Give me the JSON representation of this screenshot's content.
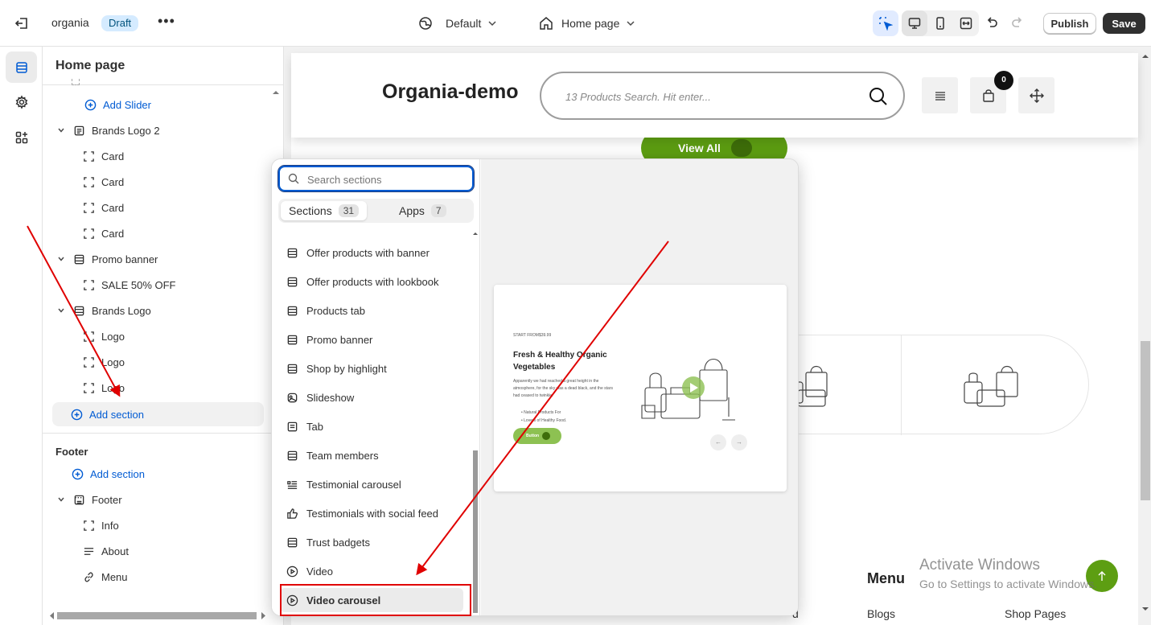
{
  "topbar": {
    "store_name": "organia",
    "status_badge": "Draft",
    "theme_label": "Default",
    "page_label": "Home page",
    "publish_label": "Publish",
    "save_label": "Save"
  },
  "sidebar": {
    "title": "Home page",
    "tree": [
      {
        "label": "Add Slider",
        "kind": "add",
        "icon": "plus-circle-icon"
      },
      {
        "label": "Brands Logo 2",
        "kind": "section",
        "icon": "section-icon"
      },
      {
        "label": "Card",
        "kind": "block",
        "icon": "block-icon"
      },
      {
        "label": "Card",
        "kind": "block",
        "icon": "block-icon"
      },
      {
        "label": "Card",
        "kind": "block",
        "icon": "block-icon"
      },
      {
        "label": "Card",
        "kind": "block",
        "icon": "block-icon"
      },
      {
        "label": "Promo banner",
        "kind": "section",
        "icon": "section-icon"
      },
      {
        "label": "SALE 50% OFF",
        "kind": "block",
        "icon": "block-icon"
      },
      {
        "label": "Brands Logo",
        "kind": "section",
        "icon": "section-icon"
      },
      {
        "label": "Logo",
        "kind": "block",
        "icon": "block-icon"
      },
      {
        "label": "Logo",
        "kind": "block",
        "icon": "block-icon"
      },
      {
        "label": "Logo",
        "kind": "block",
        "icon": "block-icon"
      }
    ],
    "add_section_label": "Add section",
    "footer_group_label": "Footer",
    "footer_add_section_label": "Add section",
    "footer_tree": [
      {
        "label": "Footer",
        "kind": "section",
        "icon": "footer-icon"
      },
      {
        "label": "Info",
        "kind": "block",
        "icon": "block-icon"
      },
      {
        "label": "About",
        "kind": "block",
        "icon": "text-lines-icon"
      },
      {
        "label": "Menu",
        "kind": "block",
        "icon": "link-icon"
      }
    ]
  },
  "popover": {
    "search_placeholder": "Search sections",
    "tabs": [
      {
        "label": "Sections",
        "count": "31"
      },
      {
        "label": "Apps",
        "count": "7"
      }
    ],
    "items": [
      {
        "label": "Offer products with banner",
        "icon": "section-icon"
      },
      {
        "label": "Offer products with lookbook",
        "icon": "section-icon"
      },
      {
        "label": "Products tab",
        "icon": "section-icon"
      },
      {
        "label": "Promo banner",
        "icon": "section-icon"
      },
      {
        "label": "Shop by highlight",
        "icon": "section-icon"
      },
      {
        "label": "Slideshow",
        "icon": "slideshow-icon"
      },
      {
        "label": "Tab",
        "icon": "tab-icon"
      },
      {
        "label": "Team members",
        "icon": "section-icon"
      },
      {
        "label": "Testimonial carousel",
        "icon": "testimonial-icon"
      },
      {
        "label": "Testimonials with social feed",
        "icon": "thumbs-up-icon"
      },
      {
        "label": "Trust badgets",
        "icon": "section-icon"
      },
      {
        "label": "Video",
        "icon": "play-circle-icon"
      },
      {
        "label": "Video carousel",
        "icon": "play-circle-icon"
      }
    ],
    "preview": {
      "pre_title": "START FROM$39.99",
      "title": "Fresh & Healthy Organic Vegetables",
      "description": "Apparently we had reached a great height in the atmosphere, for the sky was a dead black, and the stars had ceased to twinkle.",
      "bullets": [
        "Natural Products For",
        "Lovers of Healthy Food."
      ],
      "button_label": "Button"
    }
  },
  "preview": {
    "logo": "Organia-demo",
    "search_placeholder": "13 Products Search. Hit enter...",
    "cart_count": "0",
    "view_all_label": "View All",
    "footer_menu_heading": "Menu",
    "footer_col_d": "d",
    "footer_blogs": "Blogs",
    "footer_shop_pages": "Shop Pages",
    "watermark_line1": "Activate Windows",
    "watermark_line2": "Go to Settings to activate Windows."
  },
  "colors": {
    "accent_blue": "#005bd3",
    "brand_green": "#5d9e12",
    "annotation_red": "#e00000"
  }
}
